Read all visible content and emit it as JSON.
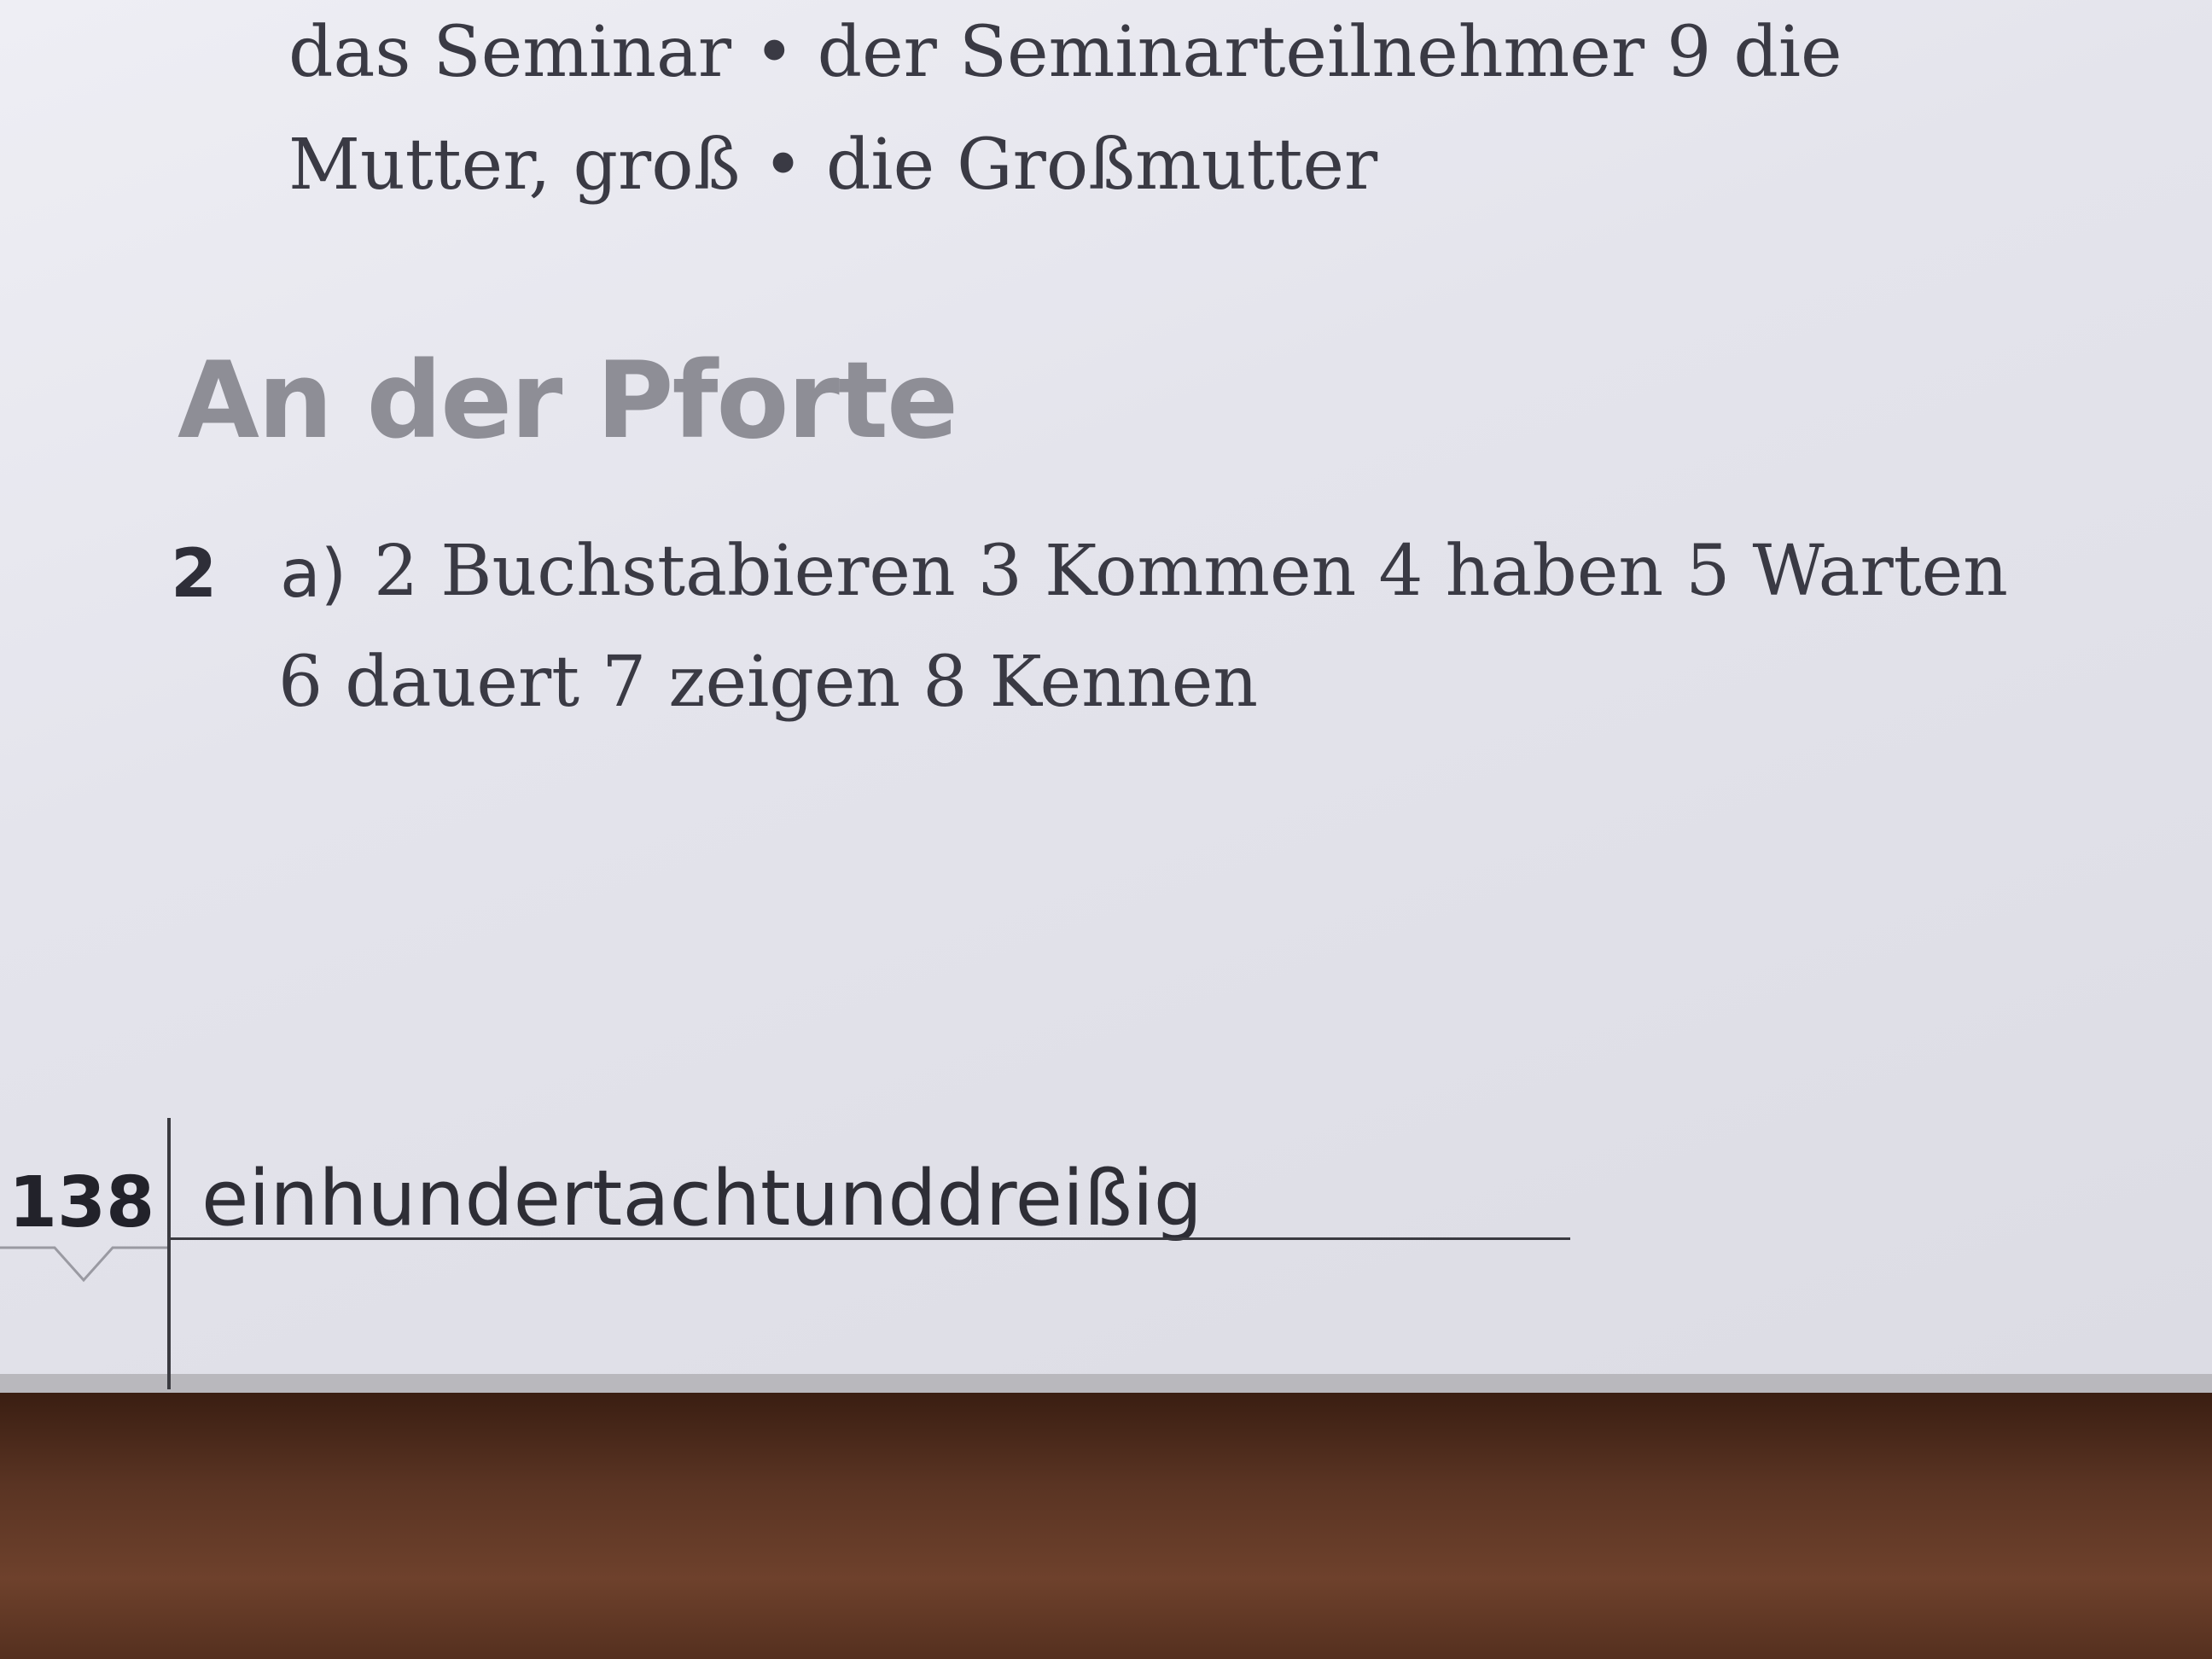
{
  "intro": {
    "line1": "das Seminar • der Seminarteilnehmer 9 die",
    "line2": "Mutter, groß • die Großmutter"
  },
  "section": {
    "title": "An der Pforte",
    "exercise_number": "2",
    "part_label": "a)",
    "line1": "2 Buchstabieren 3 Kommen 4 haben 5 Warten",
    "line2": "6 dauert 7 zeigen 8 Kennen"
  },
  "footer": {
    "page_number": "138",
    "page_word": "einhundertachtunddreißig"
  }
}
